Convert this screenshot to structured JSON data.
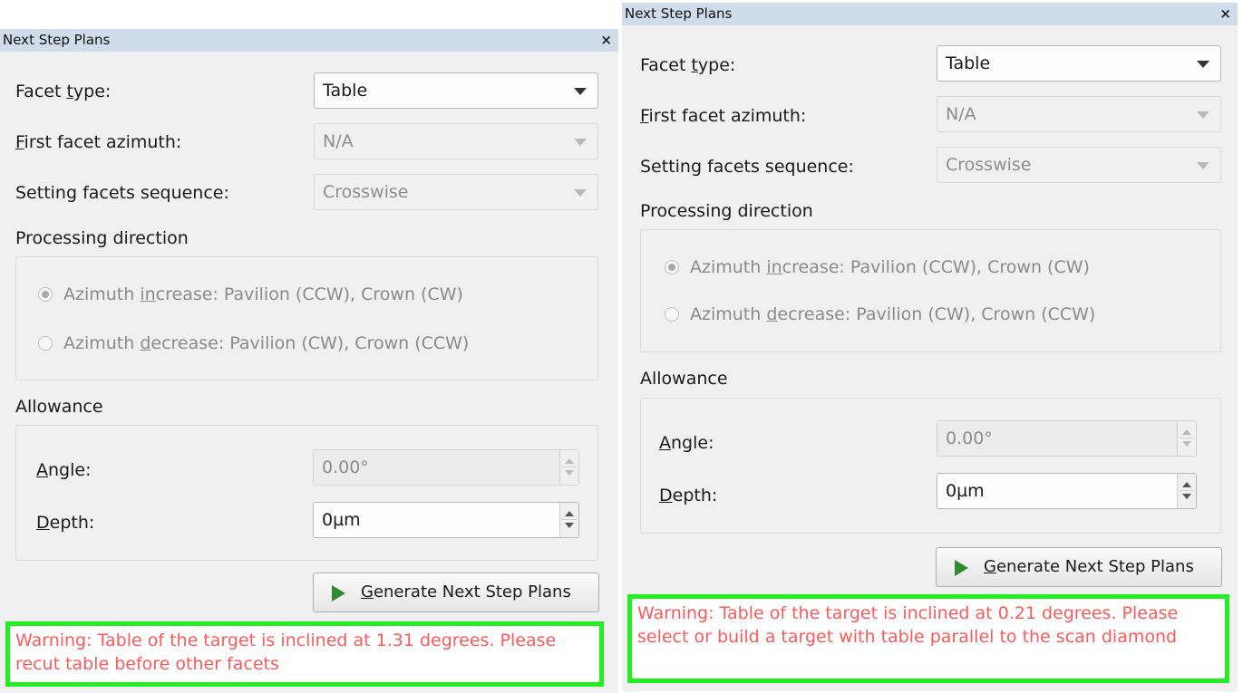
{
  "panels": [
    {
      "title": "Next Step Plans",
      "close_label": "×",
      "facet_type": {
        "label_pre": "Facet ",
        "label_u": "t",
        "label_post": "ype:",
        "value": "Table"
      },
      "first_facet": {
        "label_pre": "",
        "label_u": "F",
        "label_post": "irst facet azimuth:",
        "value": "N/A"
      },
      "sequence": {
        "label": "Setting facets sequence:",
        "value": "Crosswise"
      },
      "processing": {
        "heading": "Processing direction",
        "increase": {
          "pre": "Azimuth ",
          "u": "in",
          "post": "crease: Pavilion (CCW), Crown (CW)"
        },
        "decrease": {
          "pre": "Azimuth ",
          "u": "d",
          "post": "ecrease: Pavilion (CW), Crown (CCW)"
        }
      },
      "allowance": {
        "heading": "Allowance",
        "angle": {
          "u": "A",
          "post": "ngle:",
          "value": "0.00°"
        },
        "depth": {
          "u": "D",
          "post": "epth:",
          "value": "0µm"
        }
      },
      "generate": {
        "u": "G",
        "post": "enerate Next Step Plans"
      },
      "warning": "Warning: Table of the target is inclined at 1.31 degrees. Please recut table before other facets"
    },
    {
      "title": "Next Step Plans",
      "close_label": "×",
      "facet_type": {
        "label_pre": "Facet ",
        "label_u": "t",
        "label_post": "ype:",
        "value": "Table"
      },
      "first_facet": {
        "label_pre": "",
        "label_u": "F",
        "label_post": "irst facet azimuth:",
        "value": "N/A"
      },
      "sequence": {
        "label": "Setting facets sequence:",
        "value": "Crosswise"
      },
      "processing": {
        "heading": "Processing direction",
        "increase": {
          "pre": "Azimuth ",
          "u": "in",
          "post": "crease: Pavilion (CCW), Crown (CW)"
        },
        "decrease": {
          "pre": "Azimuth ",
          "u": "d",
          "post": "ecrease: Pavilion (CW), Crown (CCW)"
        }
      },
      "allowance": {
        "heading": "Allowance",
        "angle": {
          "u": "A",
          "post": "ngle:",
          "value": "0.00°"
        },
        "depth": {
          "u": "D",
          "post": "epth:",
          "value": "0µm"
        }
      },
      "generate": {
        "u": "G",
        "post": "enerate Next Step Plans"
      },
      "warning": "Warning: Table of the target is inclined at 0.21 degrees. Please select or build a target with table parallel to the scan diamond"
    }
  ]
}
